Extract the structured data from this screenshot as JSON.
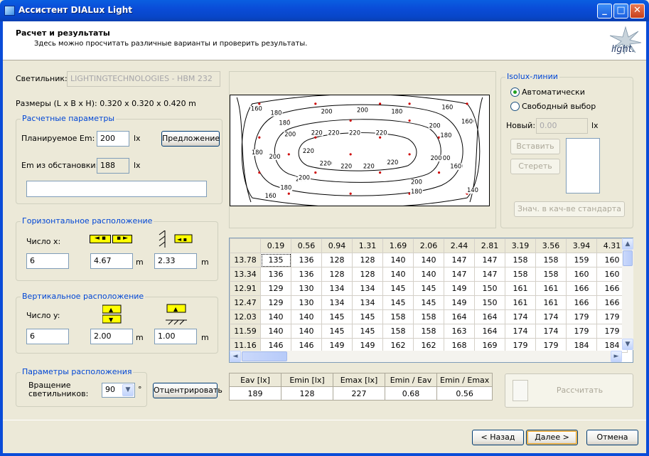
{
  "window": {
    "title": "Ассистент DIALux Light"
  },
  "header": {
    "title": "Расчет и результаты",
    "subtitle": "Здесь можно просчитать различные варианты и проверить результаты.",
    "logo_text": "light."
  },
  "luminaire": {
    "label": "Светильник:",
    "value": "LIGHTINGTECHNOLOGIES - HBM 232",
    "dimensions": "Размеры (L x B x H): 0.320 x 0.320 x 0.420 m"
  },
  "calc": {
    "title": "Расчетные параметры",
    "planned_label": "Планируемое Em:",
    "planned_value": "200",
    "planned_unit": "lx",
    "suggest_button": "Предложение",
    "scene_label": "Em из обстановки:",
    "scene_value": "188",
    "scene_unit": "lx"
  },
  "horizontal": {
    "title": "Горизонтальное расположение",
    "count_label": "Число x:",
    "count_value": "6",
    "spacing_value": "4.67",
    "spacing_unit": "m",
    "edge_value": "2.33",
    "edge_unit": "m"
  },
  "vertical": {
    "title": "Вертикальное расположение",
    "count_label": "Число y:",
    "count_value": "6",
    "spacing_value": "2.00",
    "spacing_unit": "m",
    "edge_value": "1.00",
    "edge_unit": "m"
  },
  "placement": {
    "title": "Параметры расположения",
    "rotation_label_1": "Вращение",
    "rotation_label_2": "светильников:",
    "rotation_value": "90",
    "rotation_unit": "°",
    "center_button": "Отцентрировать"
  },
  "isolux": {
    "title": "Isolux-линии",
    "auto_label": "Автоматически",
    "free_label": "Свободный выбор",
    "new_label": "Новый:",
    "new_placeholder": "0.00",
    "new_unit": "lx",
    "insert_button": "Вставить",
    "erase_button": "Стереть",
    "default_button": "Знач. в кач-ве стандарта",
    "auto_selected": true
  },
  "contours": {
    "labels": [
      "160",
      "180",
      "200",
      "200",
      "180",
      "160",
      "180",
      "200",
      "220",
      "220",
      "220",
      "220",
      "200",
      "180",
      "180",
      "200",
      "220",
      "220",
      "200",
      "180",
      "200",
      "180",
      "200",
      "220",
      "220",
      "220",
      "220",
      "200",
      "180",
      "160",
      "180",
      "200",
      "200",
      "180",
      "160",
      "160",
      "140",
      "160"
    ]
  },
  "grid": {
    "columns": [
      "0.19",
      "0.56",
      "0.94",
      "1.31",
      "1.69",
      "2.06",
      "2.44",
      "2.81",
      "3.19",
      "3.56",
      "3.94",
      "4.31"
    ],
    "rows": [
      {
        "y": "13.78",
        "values": [
          "135",
          "136",
          "128",
          "128",
          "140",
          "140",
          "147",
          "147",
          "158",
          "158",
          "159",
          "160"
        ]
      },
      {
        "y": "13.34",
        "values": [
          "136",
          "136",
          "128",
          "128",
          "140",
          "140",
          "147",
          "147",
          "158",
          "158",
          "160",
          "160"
        ]
      },
      {
        "y": "12.91",
        "values": [
          "129",
          "130",
          "134",
          "134",
          "145",
          "145",
          "149",
          "150",
          "161",
          "161",
          "166",
          "166"
        ]
      },
      {
        "y": "12.47",
        "values": [
          "129",
          "130",
          "134",
          "134",
          "145",
          "145",
          "149",
          "150",
          "161",
          "161",
          "166",
          "166"
        ]
      },
      {
        "y": "12.03",
        "values": [
          "140",
          "140",
          "145",
          "145",
          "158",
          "158",
          "164",
          "164",
          "174",
          "174",
          "179",
          "179"
        ]
      },
      {
        "y": "11.59",
        "values": [
          "140",
          "140",
          "145",
          "145",
          "158",
          "158",
          "163",
          "164",
          "174",
          "174",
          "179",
          "179"
        ]
      },
      {
        "y": "11.16",
        "values": [
          "146",
          "146",
          "149",
          "149",
          "162",
          "162",
          "168",
          "169",
          "179",
          "179",
          "184",
          "184"
        ]
      }
    ]
  },
  "results": {
    "headers": [
      "Eav [lx]",
      "Emin [lx]",
      "Emax [lx]",
      "Emin / Eav",
      "Emin / Emax"
    ],
    "values": [
      "189",
      "128",
      "227",
      "0.68",
      "0.56"
    ]
  },
  "calculate_button": "Рассчитать",
  "nav": {
    "back": "< Назад",
    "next": "Далее >",
    "cancel": "Отмена"
  }
}
